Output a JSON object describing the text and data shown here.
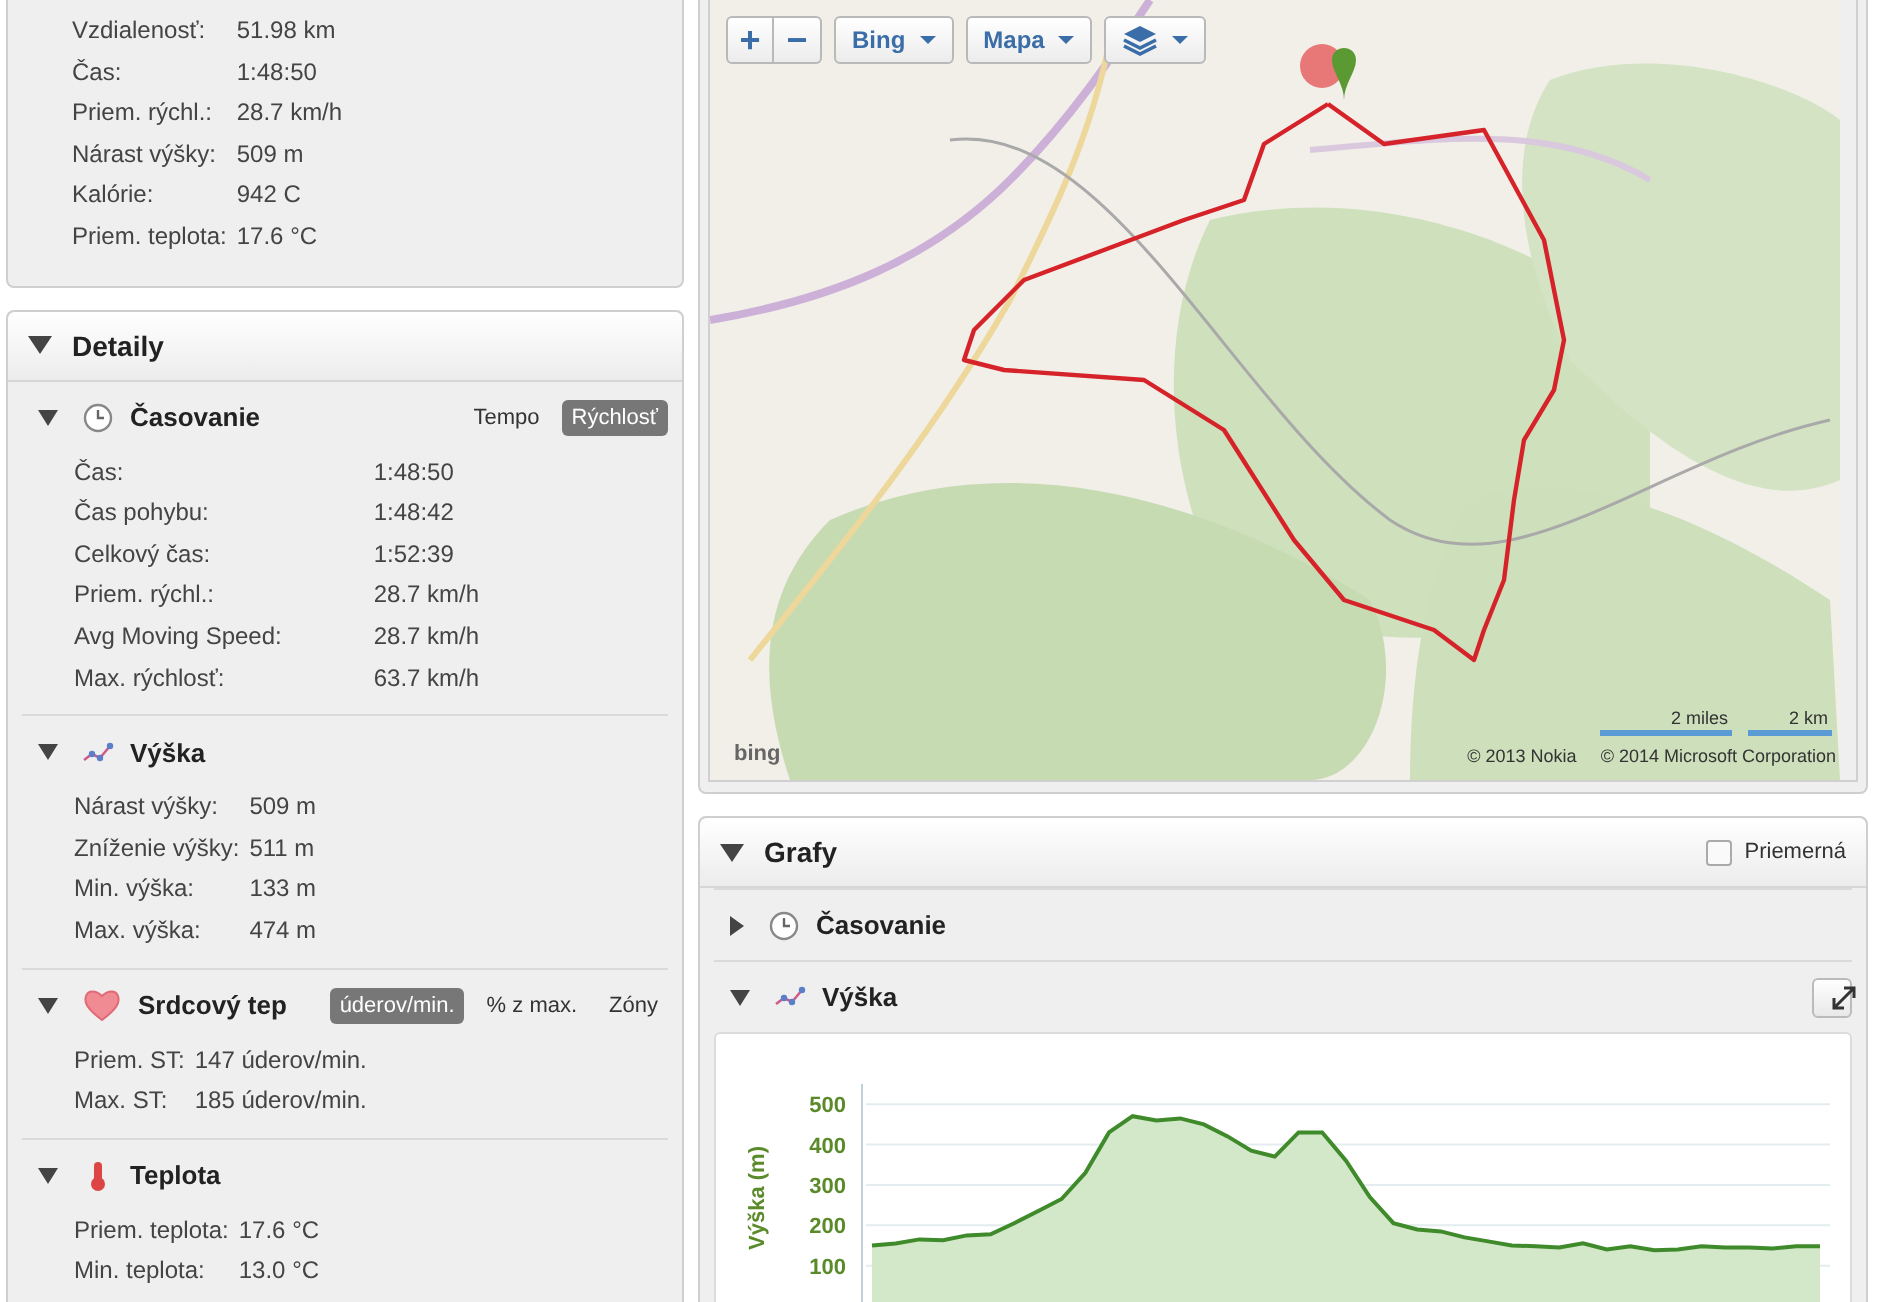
{
  "summary": {
    "rows": [
      {
        "label": "Vzdialenosť:",
        "value": "51.98 km"
      },
      {
        "label": "Čas:",
        "value": "1:48:50"
      },
      {
        "label": "Priem. rýchl.:",
        "value": "28.7 km/h"
      },
      {
        "label": "Nárast výšky:",
        "value": "509 m"
      },
      {
        "label": "Kalórie:",
        "value": "942 C"
      },
      {
        "label": "Priem. teplota:",
        "value": "17.6 °C"
      }
    ]
  },
  "details": {
    "title": "Detaily",
    "expanded": true,
    "sections": [
      {
        "kind": "clock",
        "title": "Časovanie",
        "expanded": true,
        "toggles": [
          {
            "label": "Tempo",
            "selected": false
          },
          {
            "label": "Rýchlosť",
            "selected": true
          }
        ],
        "rows": [
          {
            "label": "Čas:",
            "value": "1:48:50"
          },
          {
            "label": "Čas pohybu:",
            "value": "1:48:42"
          },
          {
            "label": "Celkový čas:",
            "value": "1:52:39"
          },
          {
            "label": "Priem. rýchl.:",
            "value": "28.7 km/h"
          },
          {
            "label": "Avg Moving Speed:",
            "value": "28.7 km/h"
          },
          {
            "label": "Max. rýchlosť:",
            "value": "63.7 km/h"
          }
        ]
      },
      {
        "kind": "elevation",
        "title": "Výška",
        "expanded": true,
        "rows": [
          {
            "label": "Nárast výšky:",
            "value": "509 m"
          },
          {
            "label": "Zníženie výšky:",
            "value": "511 m"
          },
          {
            "label": "Min. výška:",
            "value": "133 m"
          },
          {
            "label": "Max. výška:",
            "value": "474 m"
          }
        ]
      },
      {
        "kind": "heart",
        "title": "Srdcový tep",
        "expanded": true,
        "toggles": [
          {
            "label": "úderov/min.",
            "selected": true
          },
          {
            "label": "% z max.",
            "selected": false
          },
          {
            "label": "Zóny",
            "selected": false
          }
        ],
        "rows": [
          {
            "label": "Priem. ST:",
            "value": "147 úderov/min."
          },
          {
            "label": "Max. ST:",
            "value": "185 úderov/min."
          }
        ]
      },
      {
        "kind": "temperature",
        "title": "Teplota",
        "expanded": true,
        "rows": [
          {
            "label": "Priem. teplota:",
            "value": "17.6 °C"
          },
          {
            "label": "Min. teplota:",
            "value": "13.0 °C"
          }
        ]
      }
    ]
  },
  "map": {
    "controls": [
      {
        "kind": "zoom",
        "labels": [
          "+",
          "−"
        ]
      },
      {
        "kind": "dropdown",
        "label": "Bing"
      },
      {
        "kind": "dropdown",
        "label": "Mapa"
      },
      {
        "kind": "layers"
      }
    ],
    "logo": "bing",
    "scale": [
      "2 miles",
      "2 km"
    ],
    "attribution": [
      "© 2013 Nokia",
      "© 2014 Microsoft Corporation"
    ]
  },
  "charts": {
    "title": "Grafy",
    "expanded": true,
    "average": {
      "label": "Priemerná",
      "checked": false
    },
    "sections": [
      {
        "kind": "clock",
        "title": "Časovanie",
        "expanded": false
      },
      {
        "kind": "elevation",
        "title": "Výška",
        "expanded": true,
        "chart_data": {
          "type": "area",
          "ylabel": "Výška (m)",
          "ylim": [
            0,
            550
          ],
          "grid": true,
          "yticks": [
            100,
            200,
            300,
            400,
            500
          ],
          "series": [
            {
              "color": "#3f8a2a",
              "values": [
                150,
                155,
                165,
                163,
                175,
                178,
                205,
                235,
                265,
                330,
                430,
                470,
                460,
                465,
                450,
                420,
                385,
                370,
                430,
                430,
                360,
                270,
                205,
                190,
                185,
                170,
                160,
                150,
                148,
                145,
                155,
                140,
                148,
                138,
                140,
                148,
                145,
                145,
                142,
                148,
                148
              ]
            }
          ]
        }
      }
    ]
  }
}
